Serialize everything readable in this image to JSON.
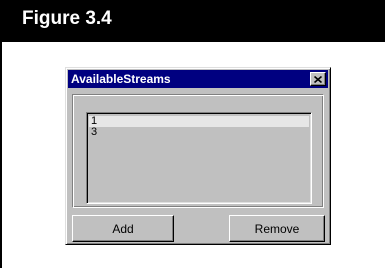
{
  "figure": {
    "title": "Figure 3.4"
  },
  "window": {
    "title": "AvailableStreams",
    "close_icon": "close-icon"
  },
  "list": {
    "items": [
      "1",
      "3"
    ],
    "selected_index": 0
  },
  "buttons": {
    "add_label": "Add",
    "remove_label": "Remove"
  },
  "colors": {
    "titlebar": "#000080",
    "face": "#c0c0c0",
    "header": "#000000"
  }
}
